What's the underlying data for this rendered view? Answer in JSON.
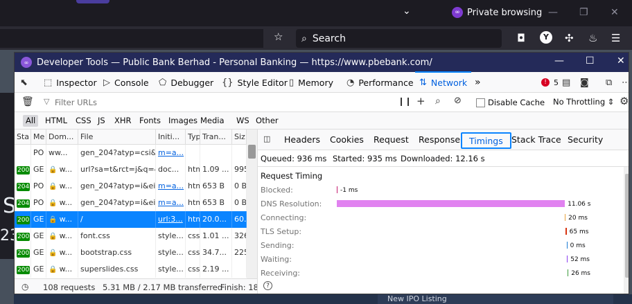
{
  "browser": {
    "private_label": "Private browsing",
    "search_placeholder": "Search",
    "account_initial": "Y"
  },
  "page_behind": {
    "big_letter": "S",
    "big_digits": "23",
    "bottom_text": "New IPO Listing"
  },
  "devtools": {
    "title": "Developer Tools — Public Bank Berhad - Personal Banking — https://www.pbebank.com/",
    "tools": [
      {
        "label": "Inspector",
        "icon": "inspector-icon",
        "glyph": "⬚"
      },
      {
        "label": "Console",
        "icon": "console-icon",
        "glyph": "▷"
      },
      {
        "label": "Debugger",
        "icon": "debugger-icon",
        "glyph": "⬠"
      },
      {
        "label": "Style Editor",
        "icon": "style-editor-icon",
        "glyph": "{}"
      },
      {
        "label": "Memory",
        "icon": "memory-icon",
        "glyph": "▯"
      },
      {
        "label": "Performance",
        "icon": "performance-icon",
        "glyph": "◔"
      },
      {
        "label": "Network",
        "icon": "network-icon",
        "glyph": "⇅"
      }
    ],
    "error_count": "5",
    "filter_placeholder": "Filter URLs",
    "disable_cache_label": "Disable Cache",
    "throttling_label": "No Throttling ⇕",
    "type_filters": [
      "All",
      "HTML",
      "CSS",
      "JS",
      "XHR",
      "Fonts",
      "Images",
      "Media",
      "WS",
      "Other"
    ],
    "columns": [
      "Sta",
      "Me",
      "Dom...",
      "File",
      "Initi...",
      "Typ",
      "Tran...",
      "Siz"
    ],
    "requests": [
      {
        "status": "",
        "method": "PO",
        "domain": "ww...",
        "file": "gen_204?atyp=csi&e",
        "initiator": "m=a...",
        "type": "",
        "transferred": "",
        "size": "",
        "lock": false,
        "selected": false
      },
      {
        "status": "200",
        "method": "GE",
        "domain": "w...",
        "file": "url?sa=t&rct=j&q=&",
        "initiator": "doc...",
        "type": "htm",
        "transferred": "1.09 ...",
        "size": "995",
        "lock": true,
        "selected": false
      },
      {
        "status": "204",
        "method": "PO",
        "domain": "w...",
        "file": "gen_204?atyp=i&ei=",
        "initiator": "m=a...",
        "type": "htm",
        "transferred": "653 B",
        "size": "0 B",
        "lock": true,
        "selected": false
      },
      {
        "status": "204",
        "method": "PO",
        "domain": "w...",
        "file": "gen_204?atyp=i&ei=",
        "initiator": "m=a...",
        "type": "htm",
        "transferred": "653 B",
        "size": "0 B",
        "lock": true,
        "selected": false
      },
      {
        "status": "200",
        "method": "GE",
        "domain": "w...",
        "file": "/",
        "initiator": "url:3...",
        "type": "htm",
        "transferred": "20.0...",
        "size": "60.",
        "lock": true,
        "selected": true
      },
      {
        "status": "200",
        "method": "GE",
        "domain": "w...",
        "file": "font.css",
        "initiator": "style...",
        "type": "css",
        "transferred": "1.01 ...",
        "size": "326",
        "lock": true,
        "selected": false
      },
      {
        "status": "200",
        "method": "GE",
        "domain": "w...",
        "file": "bootstrap.css",
        "initiator": "style...",
        "type": "css",
        "transferred": "34.7...",
        "size": "225",
        "lock": true,
        "selected": false
      },
      {
        "status": "200",
        "method": "GE",
        "domain": "w...",
        "file": "superslides.css",
        "initiator": "style...",
        "type": "css",
        "transferred": "2.19 ...",
        "size": "",
        "lock": true,
        "selected": false
      }
    ],
    "status": {
      "requests": "108 requests",
      "transferred": "5.31 MB / 2.17 MB transferred",
      "finish": "Finish: 18."
    },
    "side_tabs": [
      "Headers",
      "Cookies",
      "Request",
      "Response",
      "Timings",
      "Stack Trace",
      "Security"
    ],
    "active_side_tab": "Timings",
    "summary": {
      "queued": "Queued: 936 ms",
      "started": "Started: 935 ms",
      "downloaded": "Downloaded: 12.16 s"
    },
    "request_timing_heading": "Request Timing",
    "timings": [
      {
        "label": "Blocked:",
        "value": "-1 ms",
        "ms": -1,
        "color": "#c51b6e"
      },
      {
        "label": "DNS Resolution:",
        "value": "11.06 s",
        "ms": 11060,
        "color": "#e182f0"
      },
      {
        "label": "Connecting:",
        "value": "20 ms",
        "ms": 20,
        "color": "#e8a33c"
      },
      {
        "label": "TLS Setup:",
        "value": "65 ms",
        "ms": 65,
        "color": "#d7330f"
      },
      {
        "label": "Sending:",
        "value": "0 ms",
        "ms": 0,
        "color": "#1b7bd3"
      },
      {
        "label": "Waiting:",
        "value": "52 ms",
        "ms": 52,
        "color": "#8a3df0"
      },
      {
        "label": "Receiving:",
        "value": "26 ms",
        "ms": 26,
        "color": "#3c9b3c"
      }
    ]
  }
}
